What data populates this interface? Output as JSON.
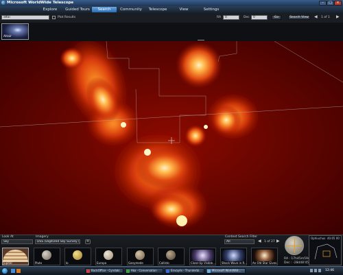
{
  "window": {
    "title": "Microsoft WorldWide Telescope"
  },
  "menu": [
    {
      "label": "Explore"
    },
    {
      "label": "Guided Tours"
    },
    {
      "label": "Search"
    },
    {
      "label": "Community"
    },
    {
      "label": "Telescope"
    },
    {
      "label": "View"
    },
    {
      "label": "Settings"
    }
  ],
  "search": {
    "query": "altai",
    "plot_results_label": "Plot Results",
    "ra_label": "RA",
    "ra_value": "0",
    "dec_label": "Dec",
    "dec_value": "0",
    "go_label": "Go",
    "search_view_label": "Search View",
    "page_label": "1 of 1"
  },
  "results": [
    {
      "label": "Altair"
    }
  ],
  "bottom": {
    "look_at_label": "Look At",
    "look_at_value": "Sky",
    "imagery_label": "Imagery",
    "imagery_value": "DSS (Digitized Sky Survey (O...",
    "filter_label": "Context Search Filter",
    "filter_value": "All",
    "page_label": "1 of 27",
    "tiles": [
      {
        "label": "Jupiter"
      },
      {
        "label": "Pluto"
      },
      {
        "label": "Io"
      },
      {
        "label": "Europa"
      },
      {
        "label": "Ganymede"
      },
      {
        "label": "Callisto"
      },
      {
        "label": "Close-Up Visible..."
      },
      {
        "label": "Shock Wave in R..."
      },
      {
        "label": "An Old Star Gives..."
      }
    ],
    "coords": {
      "ra": "RA : 17h45m59s",
      "dec": "Dec : -28d48'45\""
    },
    "constellation": "Ophiuchus",
    "fov": "40.65 00"
  },
  "taskbar": {
    "items": [
      {
        "label": "BackOffice - Cyndaki..."
      },
      {
        "label": "Ako - Conversation"
      },
      {
        "label": "Envoyés - Thunderbi..."
      },
      {
        "label": "Microsoft WorldWid..."
      }
    ],
    "clock": "12:46"
  },
  "colors": {
    "accent": "#3d84cc",
    "sky": "#7a0000",
    "emission": "#ff8a1a"
  }
}
